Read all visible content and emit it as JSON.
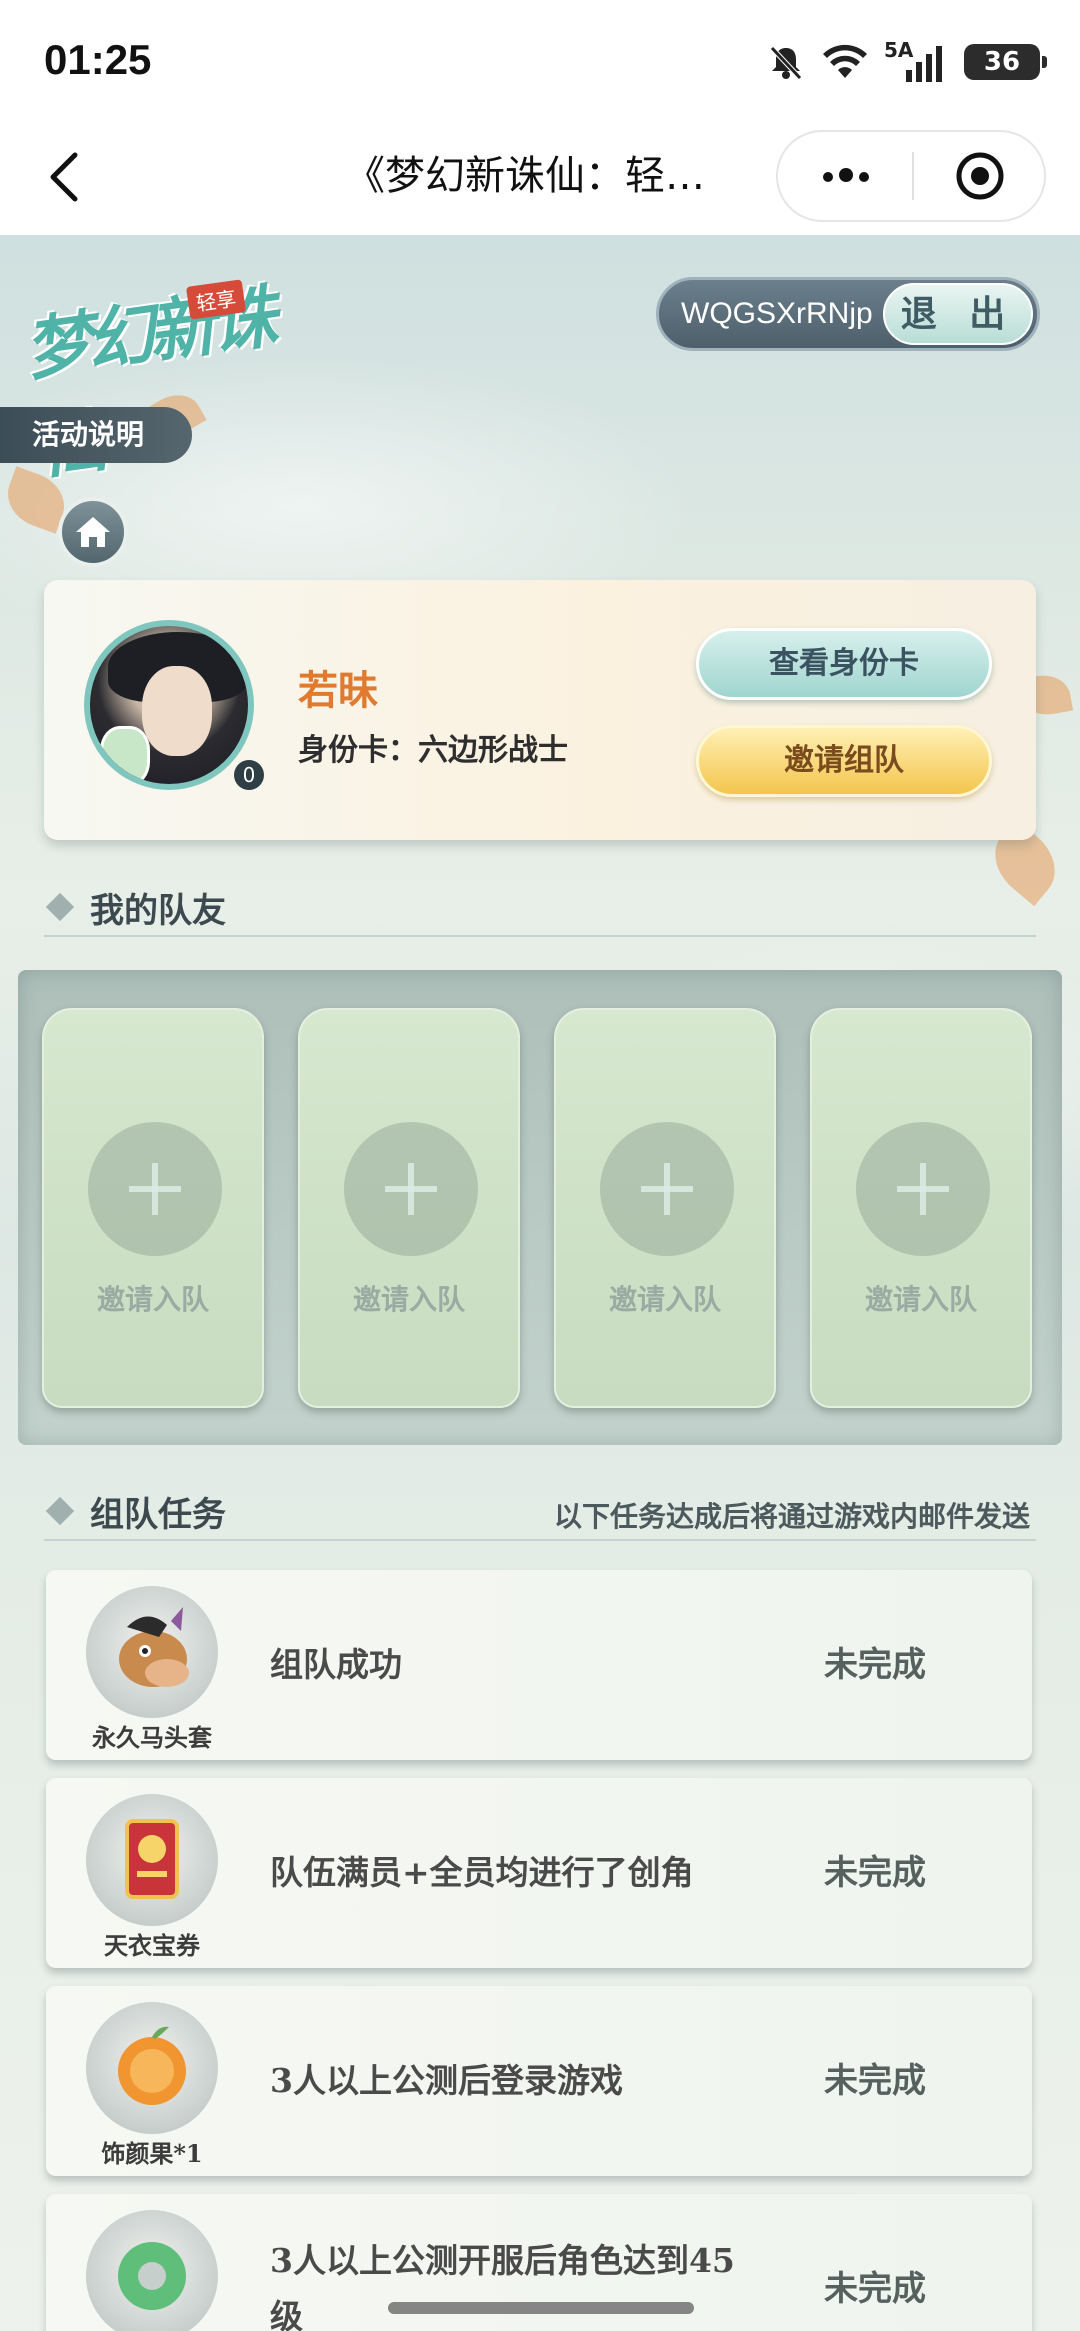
{
  "status_bar": {
    "time": "01:25",
    "network_label": "5A",
    "battery": "36",
    "icons": [
      "mute-bell-icon",
      "wifi-icon",
      "signal-icon",
      "battery-icon"
    ]
  },
  "nav": {
    "title": "《梦幻新诛仙：轻…",
    "icons": [
      "back-chevron-icon",
      "more-dots-icon",
      "mini-program-close-icon"
    ]
  },
  "header": {
    "logo_text": "梦幻新诛仙",
    "logo_badge": "轻享",
    "account_id": "WQGSXrRNjp",
    "logout_label": "退 出",
    "rules_label": "活动说明"
  },
  "profile": {
    "name": "若昧",
    "id_card_text": "身份卡：六边形战士",
    "level": "0",
    "view_id_button": "查看身份卡",
    "invite_button": "邀请组队"
  },
  "teammates": {
    "section_title": "我的队友",
    "slots": [
      {
        "label": "邀请入队"
      },
      {
        "label": "邀请入队"
      },
      {
        "label": "邀请入队"
      },
      {
        "label": "邀请入队"
      }
    ]
  },
  "tasks": {
    "section_title": "组队任务",
    "note": "以下任务达成后将通过游戏内邮件发送",
    "items": [
      {
        "reward": "永久马头套",
        "desc": "组队成功",
        "status": "未完成",
        "icon": "horse-head-icon"
      },
      {
        "reward": "天衣宝券",
        "desc": "队伍满员+全员均进行了创角",
        "status": "未完成",
        "icon": "ticket-icon"
      },
      {
        "reward": "饰颜果*1",
        "desc": "3人以上公测后登录游戏",
        "status": "未完成",
        "icon": "orange-fruit-icon"
      },
      {
        "reward": "",
        "desc": "3人以上公测开服后角色达到45级",
        "status": "未完成",
        "icon": "jade-ring-icon"
      }
    ]
  },
  "colors": {
    "accent_orange": "#e07a2e",
    "teal_button": "#9fd5cf",
    "gold_button": "#f3c54d"
  }
}
